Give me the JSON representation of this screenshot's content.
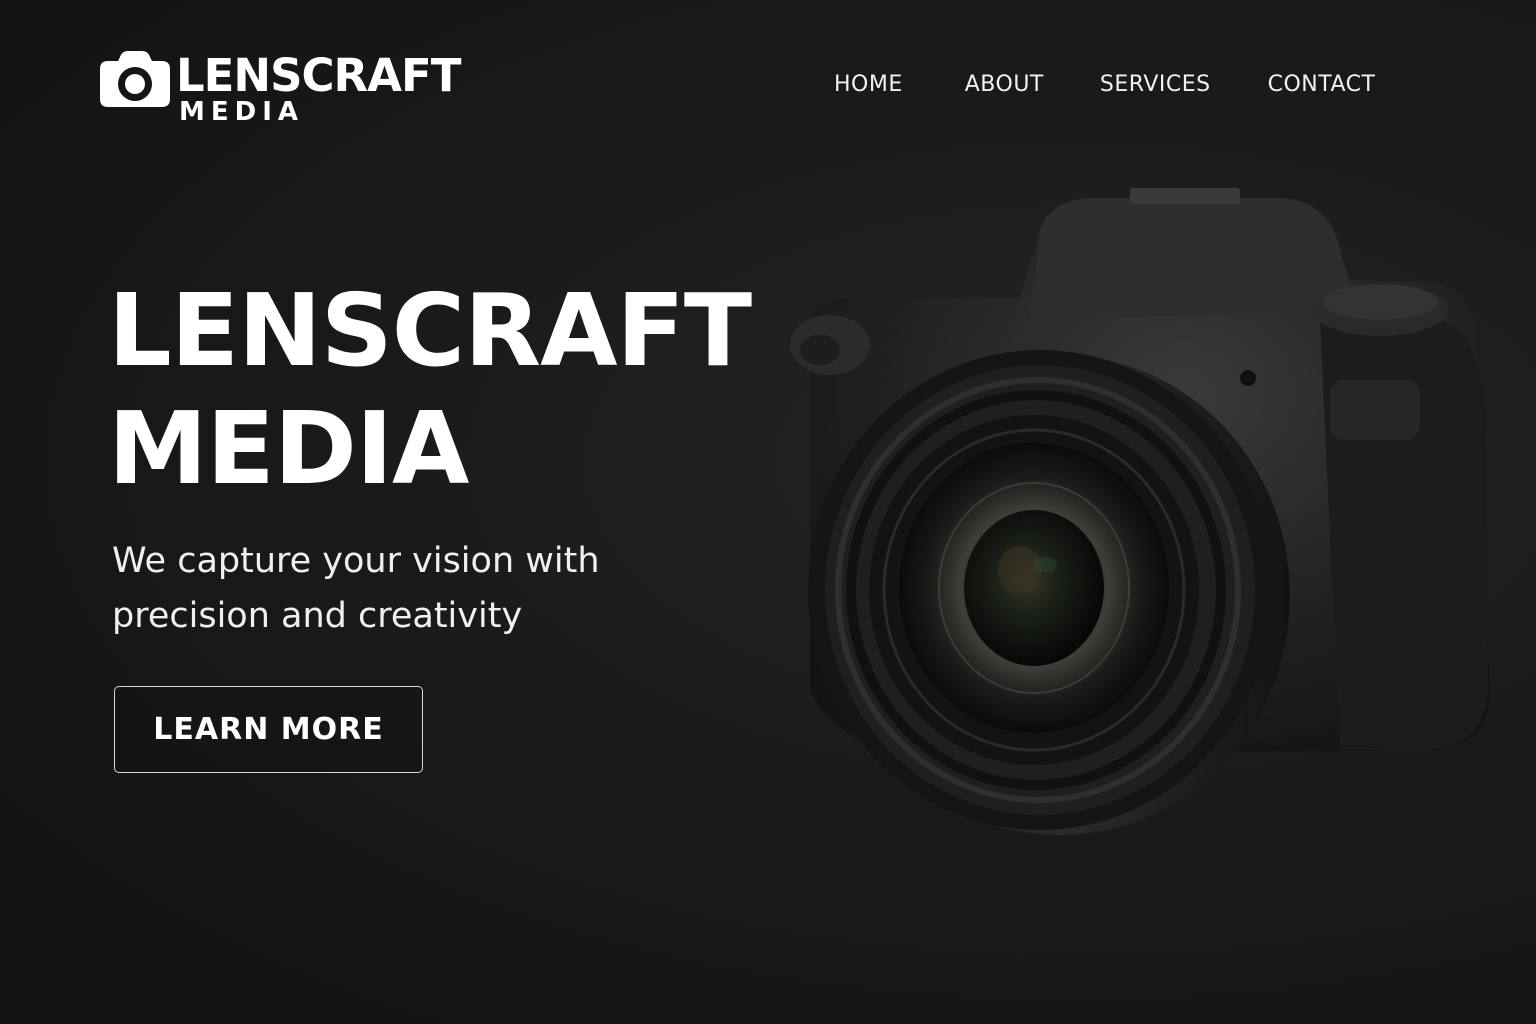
{
  "brand": {
    "name": "LENSCRAFT",
    "sub": "MEDIA",
    "logo_icon": "camera-icon"
  },
  "nav": {
    "items": [
      {
        "label": "HOME"
      },
      {
        "label": "ABOUT"
      },
      {
        "label": "SERVICES"
      },
      {
        "label": "CONTACT"
      }
    ]
  },
  "hero": {
    "title_line1": "LENSCRAFT",
    "title_line2": "MEDIA",
    "subtitle": "We capture your vision with precision and creativity",
    "cta_label": "LEARN MORE"
  },
  "colors": {
    "background": "#151515",
    "text": "#ffffff",
    "button_border": "#d9d9d9"
  }
}
